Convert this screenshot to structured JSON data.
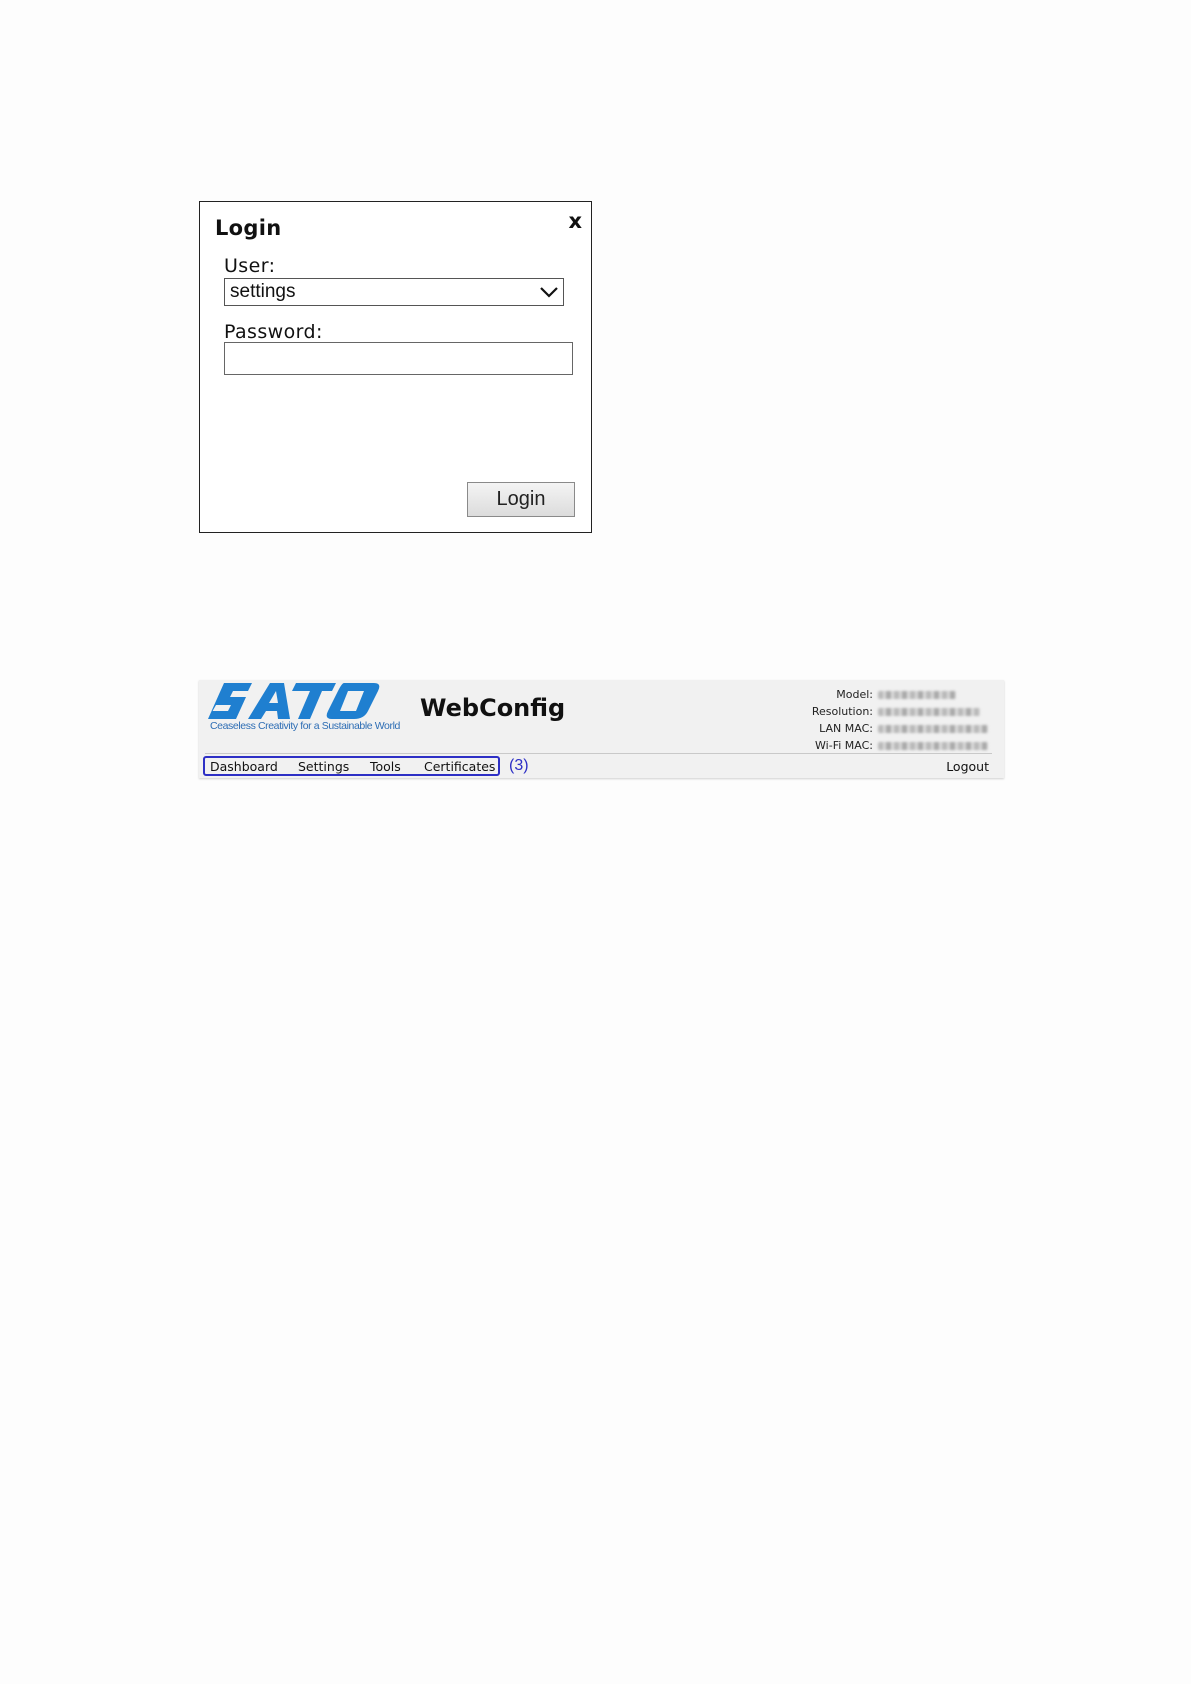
{
  "login": {
    "title": "Login",
    "close_label": "x",
    "user_label": "User:",
    "user_selected": "settings",
    "password_label": "Password:",
    "password_value": "",
    "login_button": "Login"
  },
  "header": {
    "brand_tagline": "Ceaseless Creativity for a Sustainable World",
    "app_title": "WebConfig",
    "device_info": [
      {
        "key": "Model:"
      },
      {
        "key": "Resolution:"
      },
      {
        "key": "LAN MAC:"
      },
      {
        "key": "Wi-Fi MAC:"
      }
    ],
    "nav": [
      "Dashboard",
      "Settings",
      "Tools",
      "Certificates"
    ],
    "callout": "(3)",
    "logout": "Logout"
  },
  "colors": {
    "brand_blue": "#1f7fd0",
    "callout_blue": "#2d2fc5",
    "header_bg": "#f1f1f1"
  },
  "icons": {
    "close": "close-icon",
    "dropdown": "chevron-down-icon"
  }
}
